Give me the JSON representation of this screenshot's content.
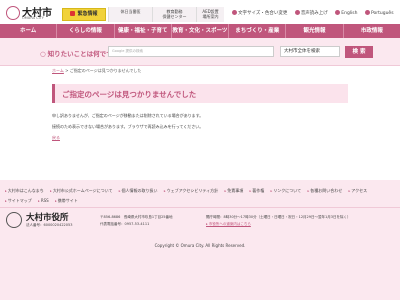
{
  "header": {
    "logo_text": "大村市",
    "logo_roman": "OMURA CITY",
    "emergency_label": "緊急情報",
    "quick_links": [
      "休日当番医",
      "教育勤務\n保健センター",
      "AED設置\n場所案内"
    ],
    "utilities": [
      "文字サイズ・色合い変更",
      "音声読み上げ",
      "English",
      "Português"
    ]
  },
  "nav": {
    "items": [
      "ホーム",
      "くらしの情報",
      "健康・福祉・子育て",
      "教育・文化・スポーツ",
      "まちづくり・産業",
      "観光情報",
      "市政情報"
    ]
  },
  "search": {
    "label": "知りたいことは何ですか？",
    "placeholder": "Google 提供の検索",
    "scope": "大村市全体を検索",
    "button": "検 索"
  },
  "main": {
    "breadcrumb_home": "ホーム",
    "breadcrumb_current": "ご指定のページは見つかりませんでした",
    "title": "ご指定のページは見つかりませんでした",
    "message_1": "申し訳ありませんが、ご指定のページが移動または削除されている場合があります。",
    "message_2": "接続のため表示できない場合があります。ブラウザで再読み込みを行ってください。",
    "back_link": "戻る"
  },
  "footer": {
    "links": [
      "大村市はこんなまち",
      "大村市公式ホームページについて",
      "個人情報の取り扱い",
      "ウェブアクセシビリティ方針",
      "免責事項",
      "著作権",
      "リンクについて",
      "各種お問い合わせ",
      "アクセス",
      "サイトマップ",
      "RSS",
      "携帯サイト"
    ],
    "org_name": "大村市役所",
    "corp_number": "法人番号：6000020422053",
    "address": "〒856-8686　長崎県大村市玖島1丁目25番地",
    "phone": "代表電話番号：0957-53-4111",
    "hours": "開庁時間：8時30分～17時30分（土曜日・日曜日・祝日・12月29日～翌年1月3日を除く）",
    "map_link": "▸ 市役所への道案内はこちら",
    "copyright": "Copyright © Omura City. All Rights Reserved."
  }
}
